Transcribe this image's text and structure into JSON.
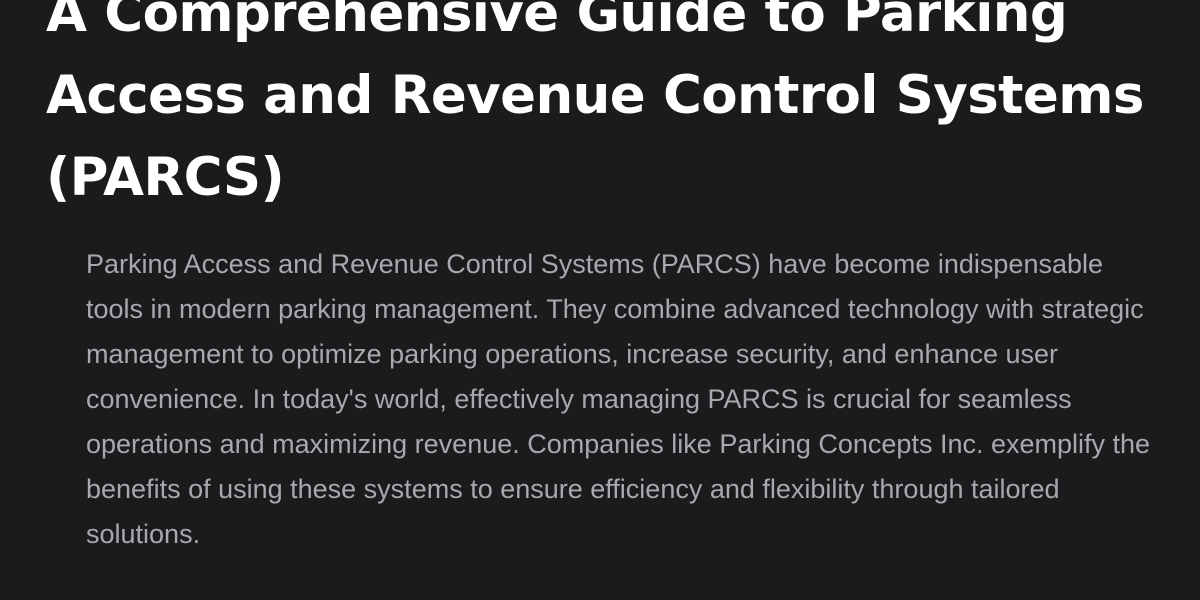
{
  "article": {
    "title": "A Comprehensive Guide to Parking Access and Revenue Control Systems (PARCS)",
    "intro": "Parking Access and Revenue Control Systems (PARCS) have become indispensable tools in modern parking management. They combine advanced technology with strategic management to optimize parking operations, increase security, and enhance user convenience. In today's world, effectively managing PARCS is crucial for seamless operations and maximizing revenue. Companies like Parking Concepts Inc. exemplify the benefits of using these systems to ensure efficiency and flexibility through tailored solutions."
  },
  "colors": {
    "background": "#1b1b1d",
    "title": "#ffffff",
    "body_text": "#a8a8ad"
  }
}
